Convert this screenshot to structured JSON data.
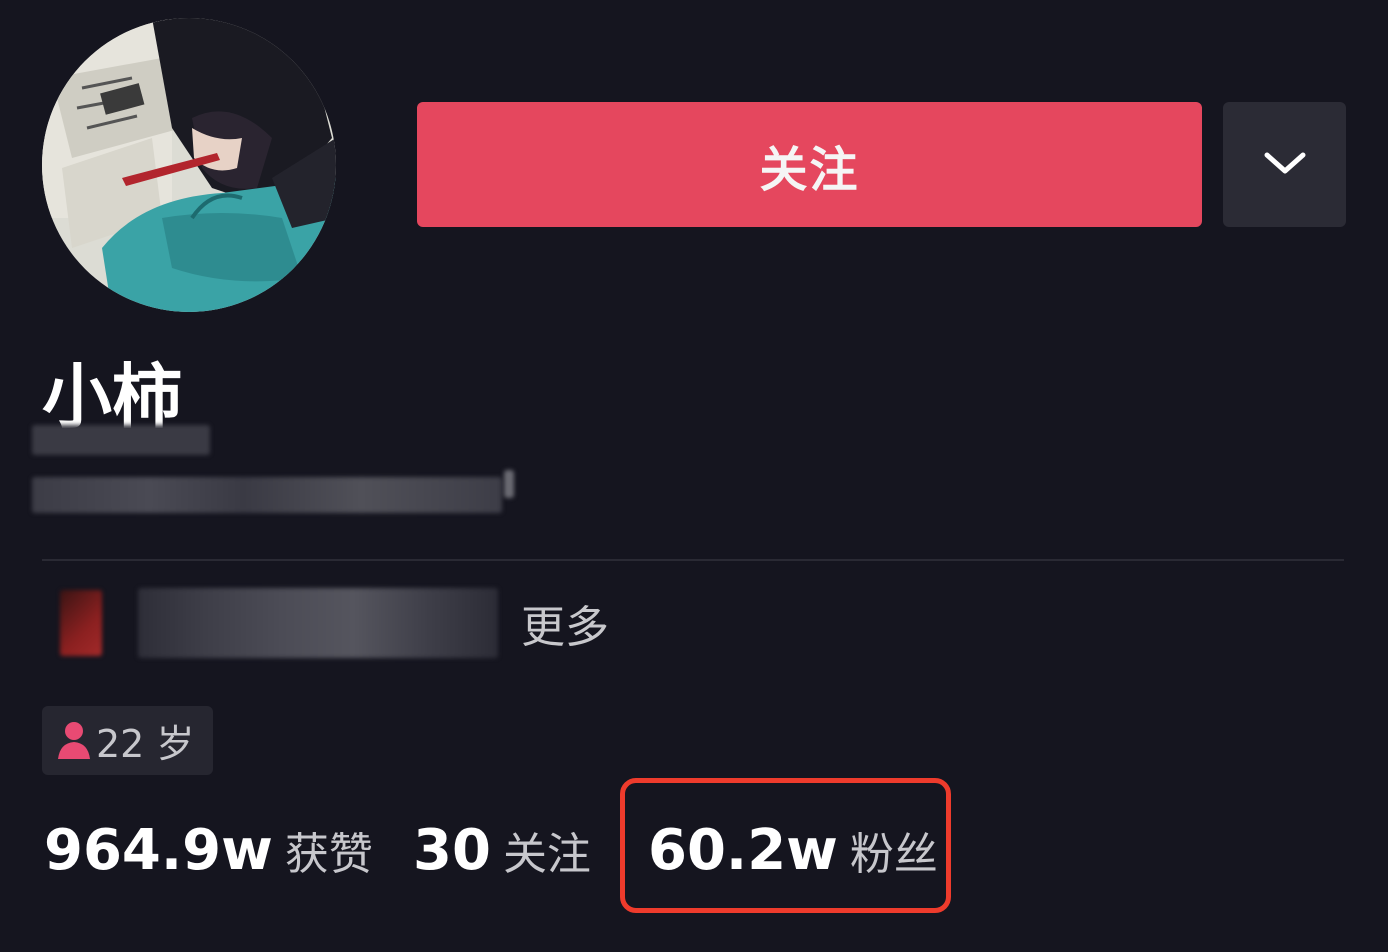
{
  "header": {
    "follow_label": "关注",
    "dropdown_icon": "chevron-down-icon"
  },
  "profile": {
    "nickname": "小柿",
    "more_label": "更多",
    "age_label": "22 岁",
    "gender_icon": "female-user-icon"
  },
  "stats": {
    "likes_value": "964.9w",
    "likes_label": "获赞",
    "following_value": "30",
    "following_label": "关注",
    "followers_value": "60.2w",
    "followers_label": "粉丝"
  },
  "colors": {
    "background": "#15151f",
    "follow_button": "#e5475e",
    "secondary_button": "#2b2b35",
    "highlight": "#ee3b2c",
    "gender_icon": "#e84a73"
  }
}
